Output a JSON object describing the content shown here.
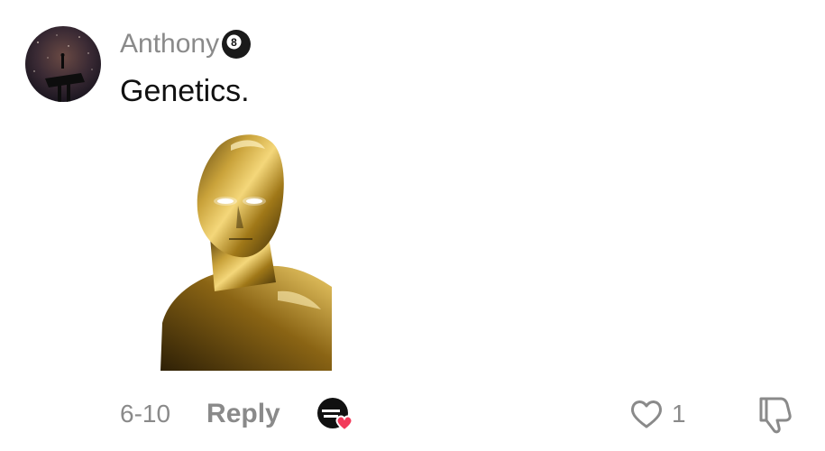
{
  "comment": {
    "username": "Anthony",
    "badge_icon": "8-ball-icon",
    "text": "Genetics.",
    "sticker": "gold-chrome-figure-sticker",
    "date": "6-10",
    "reply_label": "Reply",
    "like_count": "1",
    "creator_reaction_icon": "creator-liked-heart-icon",
    "like_icon": "heart-outline-icon",
    "dislike_icon": "thumbs-down-icon"
  },
  "colors": {
    "secondary_text": "#8a8a8a",
    "primary_text": "#111111",
    "heart_accent": "#f23a5a",
    "background": "#ffffff"
  }
}
